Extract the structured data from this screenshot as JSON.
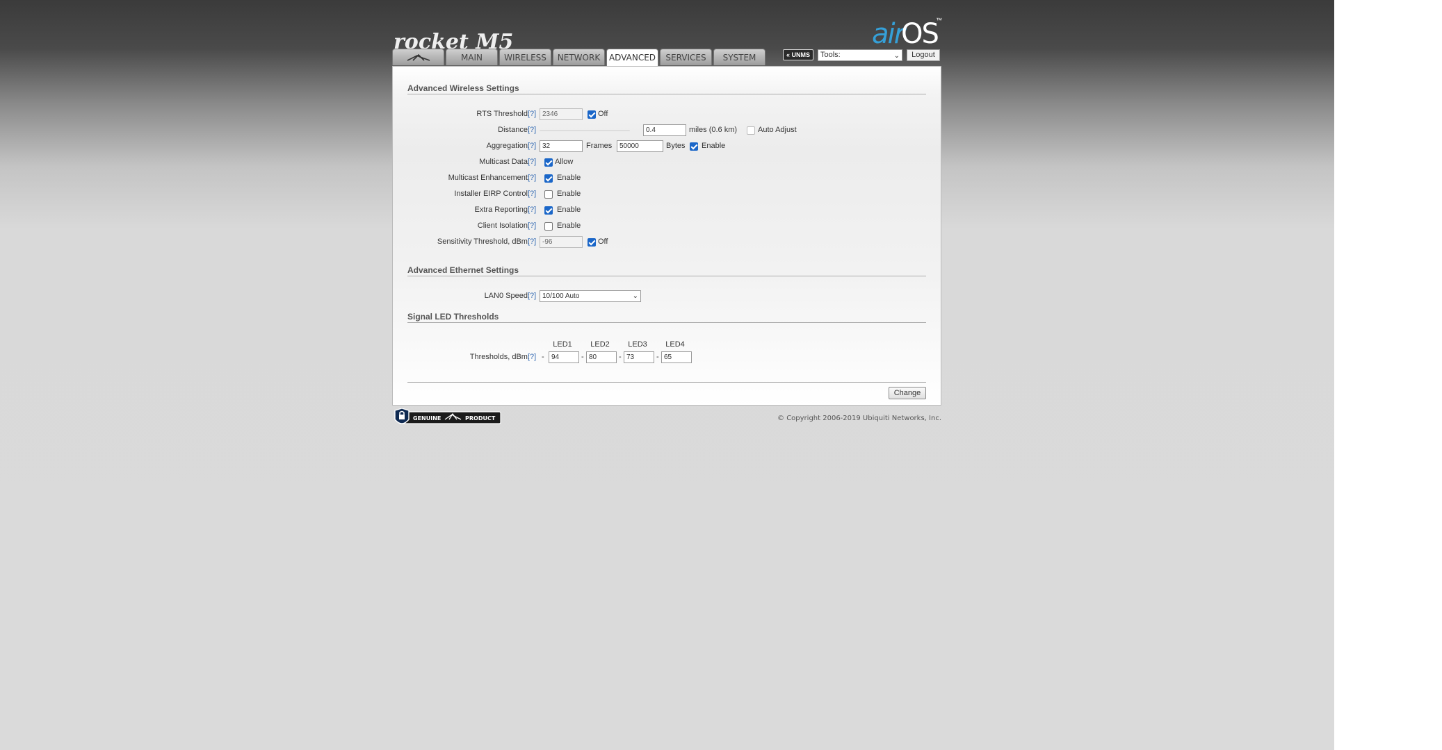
{
  "brand": {
    "product_logo": "rocket M5",
    "os_logo_air": "air",
    "os_logo_os": "OS",
    "os_logo_tm": "™",
    "colors": {
      "accent": "#35a0d8",
      "checkbox": "#1a66c8",
      "link": "#3a6fb5"
    }
  },
  "tabs": [
    {
      "label": "",
      "icon": "ubiquiti-logo-icon"
    },
    {
      "label": "MAIN"
    },
    {
      "label": "WIRELESS"
    },
    {
      "label": "NETWORK"
    },
    {
      "label": "ADVANCED",
      "active": true
    },
    {
      "label": "SERVICES"
    },
    {
      "label": "SYSTEM"
    }
  ],
  "toolbar": {
    "unms_label": "UNMS",
    "tools_value": "Tools:",
    "logout_label": "Logout"
  },
  "sections": {
    "wireless": "Advanced Wireless Settings",
    "ethernet": "Advanced Ethernet Settings",
    "led": "Signal LED Thresholds"
  },
  "help": "[?]",
  "wireless": {
    "rts": {
      "label": "RTS Threshold:",
      "value": "2346",
      "off_label": "Off",
      "off_checked": true
    },
    "distance": {
      "label": "Distance:",
      "value": "0.4",
      "unit_text": "miles (0.6 km)",
      "auto_label": "Auto Adjust",
      "auto_checked": false
    },
    "aggregation": {
      "label": "Aggregation:",
      "frames_value": "32",
      "frames_label": "Frames",
      "bytes_value": "50000",
      "bytes_label": "Bytes",
      "enable_label": "Enable",
      "enable_checked": true
    },
    "multicast_data": {
      "label": "Multicast Data:",
      "option": "Allow",
      "checked": true
    },
    "multicast_enh": {
      "label": "Multicast Enhancement:",
      "option": "Enable",
      "checked": true
    },
    "eirp": {
      "label": "Installer EIRP Control:",
      "option": "Enable",
      "checked": false
    },
    "extra_reporting": {
      "label": "Extra Reporting:",
      "option": "Enable",
      "checked": true
    },
    "client_isolation": {
      "label": "Client Isolation:",
      "option": "Enable",
      "checked": false
    },
    "sensitivity": {
      "label": "Sensitivity Threshold, dBm:",
      "value": "-96",
      "off_label": "Off",
      "off_checked": true
    }
  },
  "ethernet": {
    "lan0": {
      "label": "LAN0 Speed:",
      "value": "10/100 Auto"
    }
  },
  "led": {
    "label": "Thresholds, dBm:",
    "headers": [
      "LED1",
      "LED2",
      "LED3",
      "LED4"
    ],
    "dash": "-",
    "values": [
      "94",
      "80",
      "73",
      "65"
    ]
  },
  "change_label": "Change",
  "footer": {
    "genuine_left": "GENUINE",
    "genuine_right": "PRODUCT",
    "copyright": "© Copyright 2006-2019 Ubiquiti Networks, Inc."
  }
}
